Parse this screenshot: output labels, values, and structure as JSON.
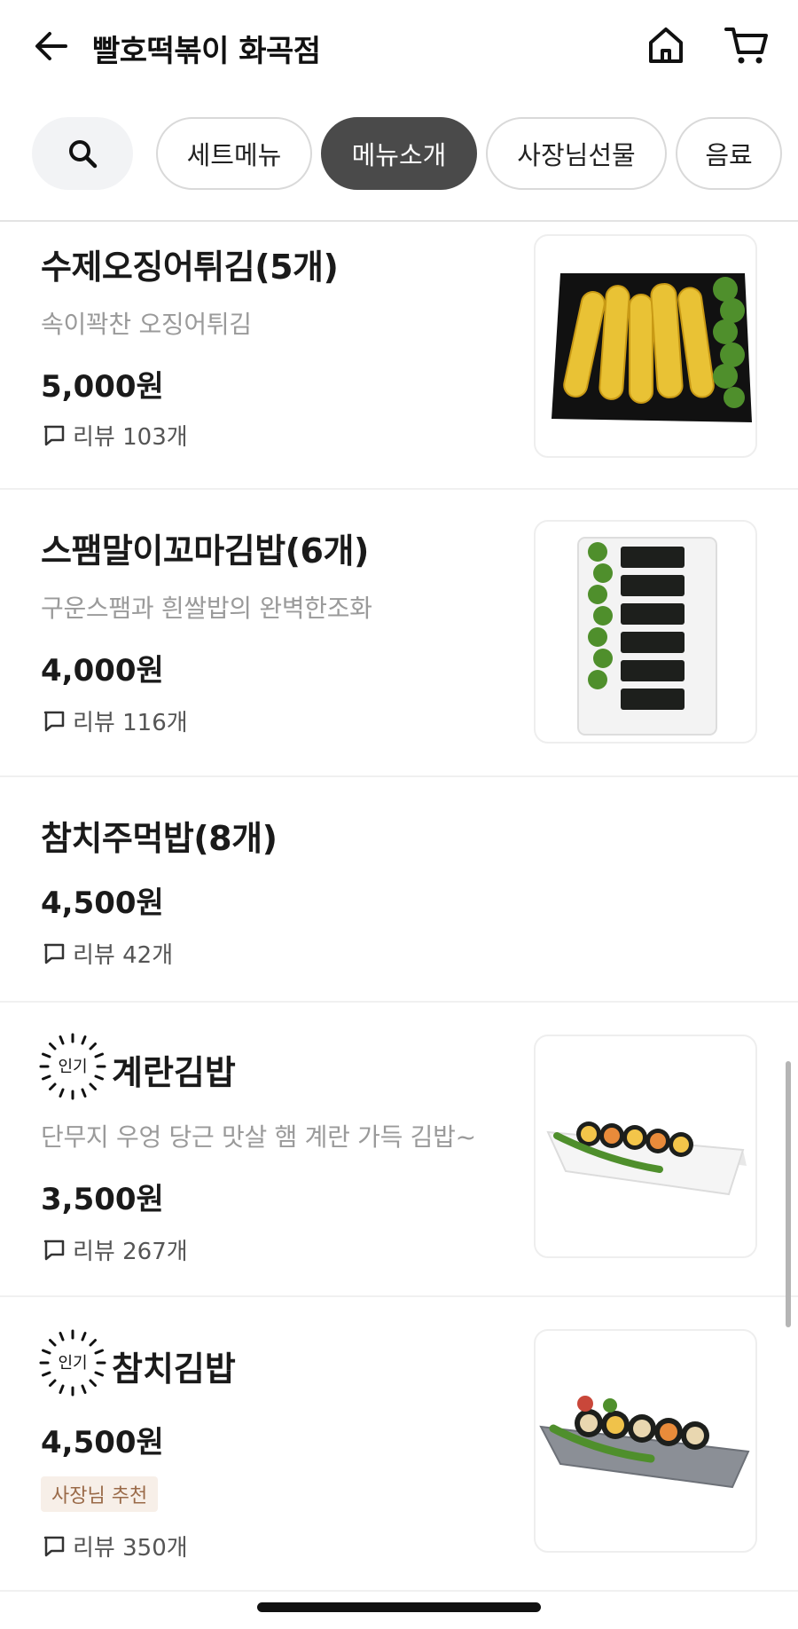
{
  "header": {
    "title": "빨호떡볶이 화곡점",
    "back_icon": "arrow-left-icon",
    "home_icon": "home-icon",
    "cart_icon": "cart-icon"
  },
  "tabs": {
    "search_icon": "search-icon",
    "items": [
      {
        "label": "세트메뉴",
        "active": false
      },
      {
        "label": "메뉴소개",
        "active": true
      },
      {
        "label": "사장님선물",
        "active": false
      },
      {
        "label": "음료",
        "active": false
      }
    ]
  },
  "menu": {
    "items": [
      {
        "name": "수제오징어튀김(5개)",
        "description": "속이꽉찬 오징어튀김",
        "price": "5,000원",
        "review": "리뷰 103개",
        "popular": false
      },
      {
        "name": "스팸말이꼬마김밥(6개)",
        "description": "구운스팸과 흰쌀밥의 완벽한조화",
        "price": "4,000원",
        "review": "리뷰 116개",
        "popular": false
      },
      {
        "name": "참치주먹밥(8개)",
        "price": "4,500원",
        "review": "리뷰 42개",
        "popular": false
      },
      {
        "name": "계란김밥",
        "description": "단무지 우엉 당근 맛살 햄 계란 가득 김밥~",
        "price": "3,500원",
        "review": "리뷰 267개",
        "popular": true,
        "badge": "인기"
      },
      {
        "name": "참치김밥",
        "price": "4,500원",
        "tag": "사장님 추천",
        "review": "리뷰 350개",
        "popular": true,
        "badge": "인기"
      }
    ]
  },
  "colors": {
    "active_tab": "#4a4a4a",
    "tag_bg": "#f7efe8",
    "tag_text": "#9a6a48",
    "muted_text": "#9a9a9a"
  }
}
